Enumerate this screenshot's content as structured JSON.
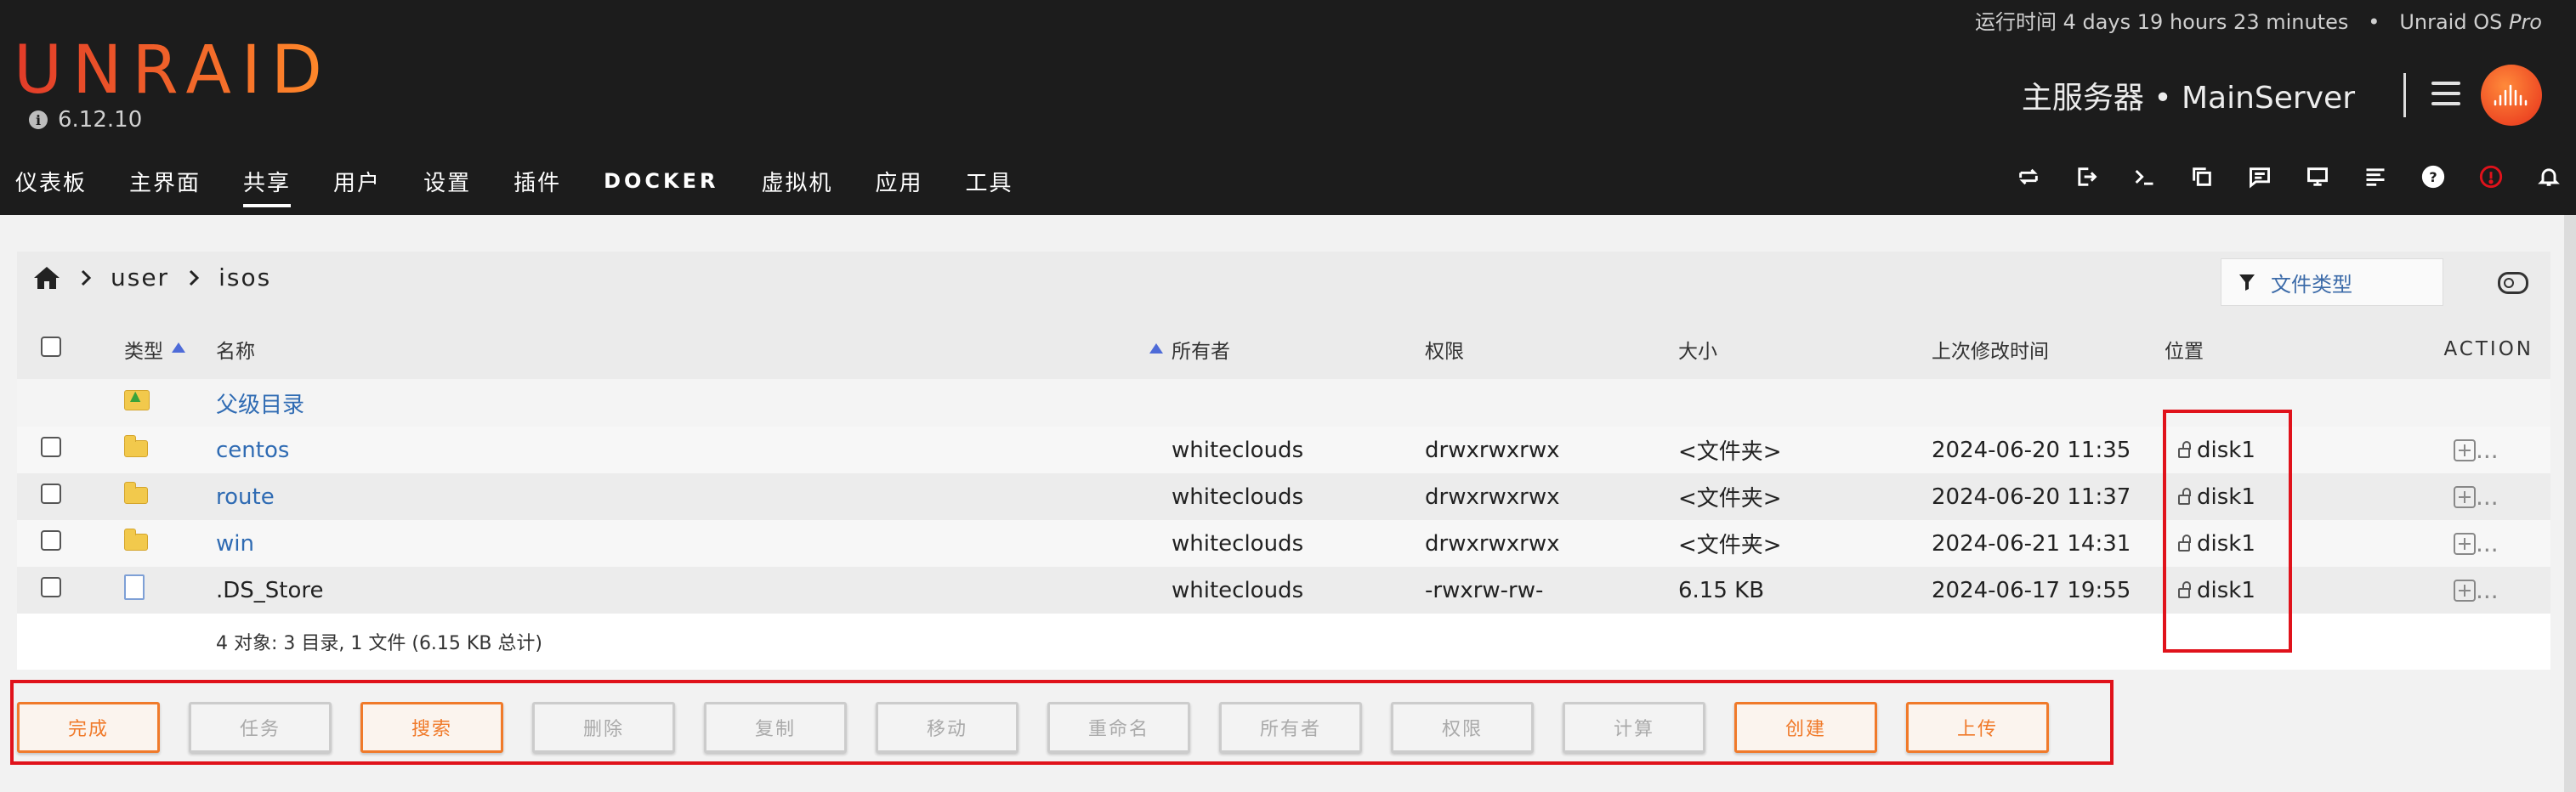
{
  "header": {
    "uptime_label": "运行时间",
    "uptime_value": "4 days 19 hours 23 minutes",
    "edition_prefix": "Unraid OS",
    "edition_suffix": "Pro",
    "logo": "UNRAID",
    "version": "6.12.10",
    "server_name": "主服务器 • MainServer"
  },
  "nav": {
    "items": [
      "仪表板",
      "主界面",
      "共享",
      "用户",
      "设置",
      "插件",
      "DOCKER",
      "虚拟机",
      "应用",
      "工具"
    ],
    "active": "共享",
    "right_icons": [
      "transfer-icon",
      "logout-icon",
      "terminal-icon",
      "copy-icon",
      "feedback-icon",
      "monitor-icon",
      "log-icon",
      "help-icon",
      "info-alert-icon",
      "bell-icon"
    ]
  },
  "breadcrumb": {
    "parts": [
      "user",
      "isos"
    ]
  },
  "filter": {
    "label": "文件类型"
  },
  "table": {
    "headers": {
      "type": "类型",
      "name": "名称",
      "owner": "所有者",
      "perm": "权限",
      "size": "大小",
      "mtime": "上次修改时间",
      "location": "位置",
      "action": "ACTION"
    },
    "parent_label": "父级目录",
    "rows": [
      {
        "name": "centos",
        "kind": "folder",
        "owner": "whiteclouds",
        "perm": "drwxrwxrwx",
        "size": "<文件夹>",
        "mtime": "2024-06-20 11:35",
        "location": "disk1"
      },
      {
        "name": "route",
        "kind": "folder",
        "owner": "whiteclouds",
        "perm": "drwxrwxrwx",
        "size": "<文件夹>",
        "mtime": "2024-06-20 11:37",
        "location": "disk1"
      },
      {
        "name": "win",
        "kind": "folder",
        "owner": "whiteclouds",
        "perm": "drwxrwxrwx",
        "size": "<文件夹>",
        "mtime": "2024-06-21 14:31",
        "location": "disk1"
      },
      {
        "name": ".DS_Store",
        "kind": "file",
        "owner": "whiteclouds",
        "perm": "-rwxrw-rw-",
        "size": "6.15 KB",
        "mtime": "2024-06-17 19:55",
        "location": "disk1"
      }
    ],
    "summary": "4 对象: 3 目录, 1 文件 (6.15 KB 总计)",
    "action_dots": "..."
  },
  "buttons": [
    {
      "label": "完成",
      "enabled": true
    },
    {
      "label": "任务",
      "enabled": false
    },
    {
      "label": "搜索",
      "enabled": true
    },
    {
      "label": "删除",
      "enabled": false
    },
    {
      "label": "复制",
      "enabled": false
    },
    {
      "label": "移动",
      "enabled": false
    },
    {
      "label": "重命名",
      "enabled": false
    },
    {
      "label": "所有者",
      "enabled": false
    },
    {
      "label": "权限",
      "enabled": false
    },
    {
      "label": "计算",
      "enabled": false
    },
    {
      "label": "创建",
      "enabled": true
    },
    {
      "label": "上传",
      "enabled": true
    }
  ],
  "colors": {
    "accent": "#f07a2a",
    "link": "#2f6bb3",
    "highlight_box": "#e0121b",
    "header_bg": "#1c1c1c"
  }
}
